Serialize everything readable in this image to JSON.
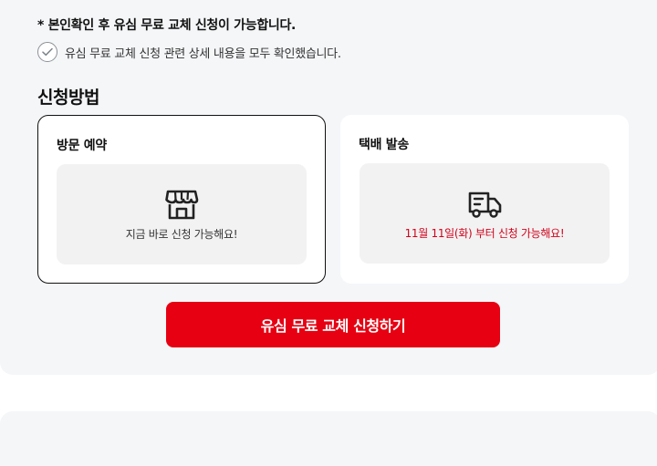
{
  "notice": "* 본인확인 후 유심 무료 교체 신청이 가능합니다.",
  "confirm": {
    "label": "유심 무료 교체 신청 관련 상세 내용을 모두 확인했습니다.",
    "checked": false
  },
  "method_section": {
    "title": "신청방법",
    "options": [
      {
        "title": "방문 예약",
        "icon": "store-icon",
        "message": "지금 바로 신청 가능해요!",
        "selected": true
      },
      {
        "title": "택배 발송",
        "icon": "delivery-truck-icon",
        "message": "11월 11일(화) 부터 신청 가능해요!",
        "selected": false
      }
    ]
  },
  "cta_label": "유심 무료 교체 신청하기",
  "colors": {
    "accent": "#e60012",
    "highlight_text": "#d0021b",
    "panel_bg": "#f4f6f8"
  }
}
